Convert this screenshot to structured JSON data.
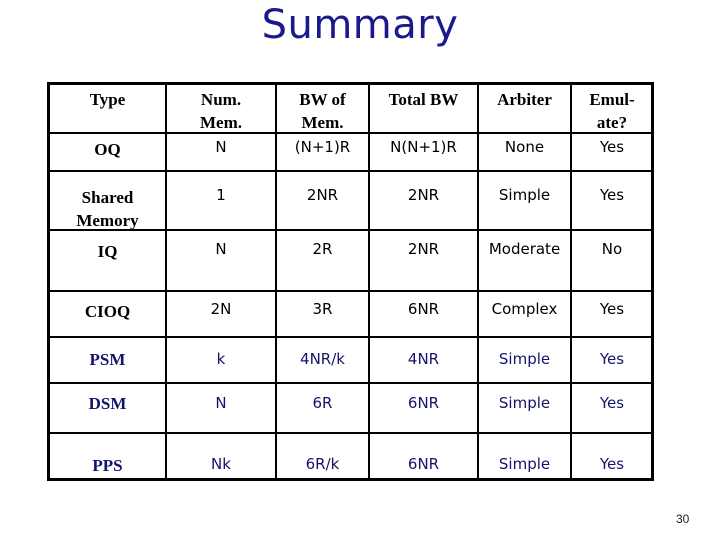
{
  "title": "Summary",
  "page_number": "30",
  "colors": {
    "title": "#1a1a8c",
    "navy_rows": "#14146b"
  },
  "table": {
    "headers": [
      [
        "Type"
      ],
      [
        "Num.",
        "Mem."
      ],
      [
        "BW of",
        "Mem."
      ],
      [
        "Total BW"
      ],
      [
        "Arbiter"
      ],
      [
        "Emul-",
        "ate?"
      ]
    ],
    "rows": [
      {
        "type": [
          "OQ"
        ],
        "num_mem": "N",
        "bw_mem": "(N+1)R",
        "total_bw": "N(N+1)R",
        "arbiter": "None",
        "emulate": "Yes"
      },
      {
        "type": [
          "Shared",
          "Memory"
        ],
        "num_mem": "1",
        "bw_mem": "2NR",
        "total_bw": "2NR",
        "arbiter": "Simple",
        "emulate": "Yes"
      },
      {
        "type": [
          "IQ"
        ],
        "num_mem": "N",
        "bw_mem": "2R",
        "total_bw": "2NR",
        "arbiter": "Moderate",
        "emulate": "No"
      },
      {
        "type": [
          "CIOQ"
        ],
        "num_mem": "2N",
        "bw_mem": "3R",
        "total_bw": "6NR",
        "arbiter": "Complex",
        "emulate": "Yes"
      },
      {
        "type": [
          "PSM"
        ],
        "num_mem": "k",
        "bw_mem": "4NR/k",
        "total_bw": "4NR",
        "arbiter": "Simple",
        "emulate": "Yes"
      },
      {
        "type": [
          "DSM"
        ],
        "num_mem": "N",
        "bw_mem": "6R",
        "total_bw": "6NR",
        "arbiter": "Simple",
        "emulate": "Yes"
      },
      {
        "type": [
          "PPS"
        ],
        "num_mem": "Nk",
        "bw_mem": "6R/k",
        "total_bw": "6NR",
        "arbiter": "Simple",
        "emulate": "Yes"
      }
    ]
  }
}
